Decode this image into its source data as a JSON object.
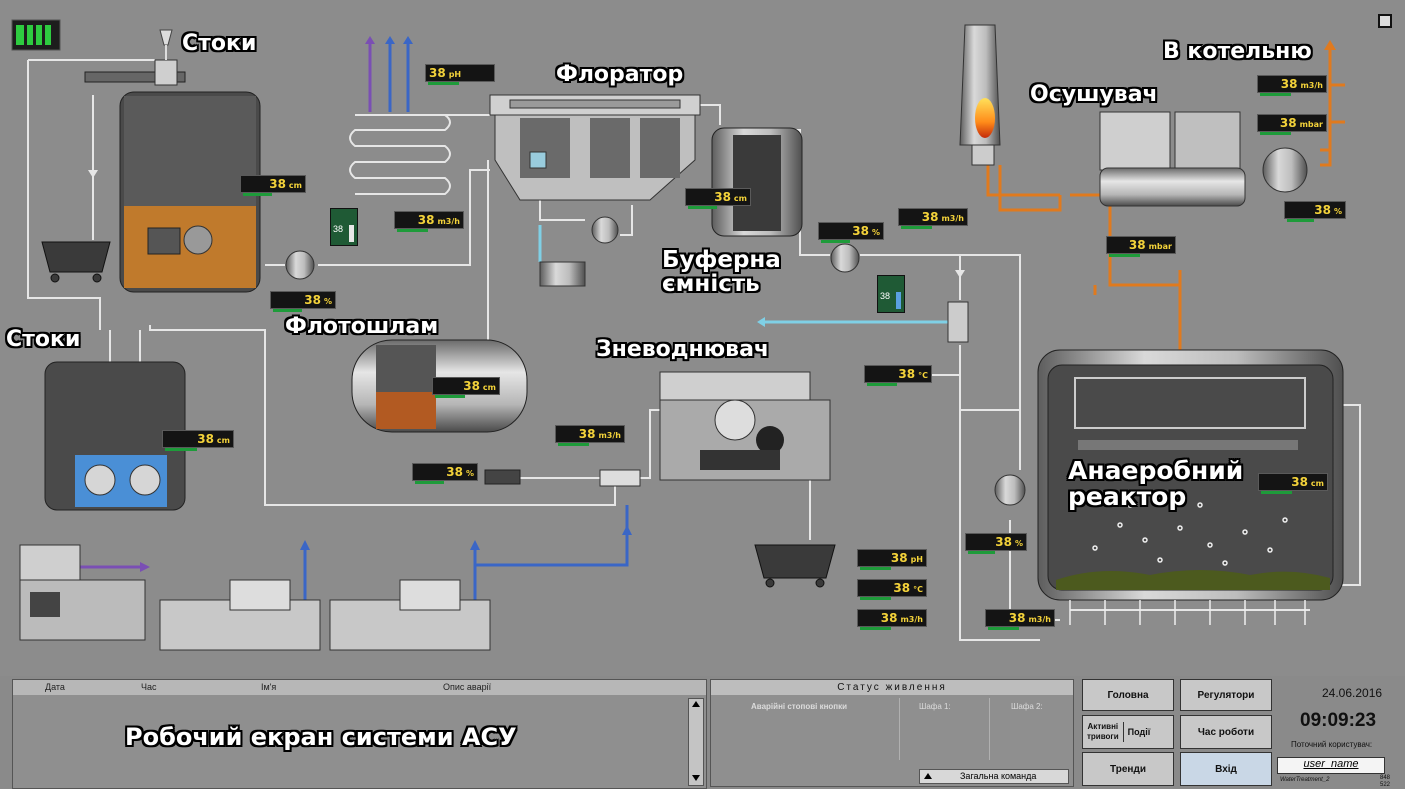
{
  "labels": {
    "stoky_top": "Стоки",
    "stoky_left": "Стоки",
    "florator": "Флоратор",
    "flotoshlam": "Флотошлам",
    "buferna": "Буферна\nємність",
    "znevodnyuvach": "Зневоднювач",
    "osushuvach": "Осушувач",
    "v_kotelnyu": "В котельню",
    "reactor": "Анаеробний\nреактор"
  },
  "readouts": {
    "r_ph_florator": {
      "value": "38",
      "unit": "pH"
    },
    "r_cm_tank1": {
      "value": "38",
      "unit": "cm"
    },
    "r_m3h_1": {
      "value": "38",
      "unit": "m3/h"
    },
    "r_pct_pump1": {
      "value": "38",
      "unit": "%"
    },
    "r_cm_buffer": {
      "value": "38",
      "unit": "cm"
    },
    "r_pct_buffer": {
      "value": "38",
      "unit": "%"
    },
    "r_m3h_buffer": {
      "value": "38",
      "unit": "m3/h"
    },
    "r_m3h_boiler": {
      "value": "38",
      "unit": "m3/h"
    },
    "r_mbar_boiler": {
      "value": "38",
      "unit": "mbar"
    },
    "r_pct_blower": {
      "value": "38",
      "unit": "%"
    },
    "r_mbar_reactor": {
      "value": "38",
      "unit": "mbar"
    },
    "r_cm_tank2": {
      "value": "38",
      "unit": "cm"
    },
    "r_cm_flotoshlam": {
      "value": "38",
      "unit": "cm"
    },
    "r_m3h_screw": {
      "value": "38",
      "unit": "m3/h"
    },
    "r_pct_screw": {
      "value": "38",
      "unit": "%"
    },
    "r_c_heat": {
      "value": "38",
      "unit": "°C"
    },
    "r_cm_reactor": {
      "value": "38",
      "unit": "cm"
    },
    "r_pct_recirc": {
      "value": "38",
      "unit": "%"
    },
    "r_ph_reactor": {
      "value": "38",
      "unit": "pH"
    },
    "r_c_reactor": {
      "value": "38",
      "unit": "°C"
    },
    "r_m3h_reactor_a": {
      "value": "38",
      "unit": "m3/h"
    },
    "r_m3h_reactor_b": {
      "value": "38",
      "unit": "m3/h"
    }
  },
  "valve_level_1": "38",
  "valve_level_1_fill": 0.55,
  "valve_level_2": "38",
  "valve_level_2_fill": 0.55,
  "alarms": {
    "col_date": "Дата",
    "col_time": "Час",
    "col_name": "Ім'я",
    "col_desc": "Опис аварії",
    "watermark": "Робочий екран системи АСУ"
  },
  "power": {
    "title": "Статус живлення",
    "col_buttons": "Аварійні стопові кнопки",
    "col_cab1": "Шафа 1:",
    "col_cab2": "Шафа 2:",
    "general_cmd": "Загальна команда"
  },
  "nav": {
    "home": "Головна",
    "regulators": "Регулятори",
    "active_alarms": "Активні\nтривоги",
    "events": "Події",
    "runtime": "Час роботи",
    "trends": "Тренди",
    "login": "Вхід"
  },
  "status": {
    "date": "24.06.2016",
    "time": "09:09:23",
    "current_user_label": "Поточний користувач:",
    "user_name": "user_name",
    "project": "WaterTreatment_2",
    "corner_a": "848",
    "corner_b": "522"
  },
  "colors": {
    "background": "#8c8c8c",
    "sludge": "#c07a2c",
    "water": "#4a8fd6",
    "gas_pipe": "#e07a1e",
    "purple_pipe": "#7a4fb4",
    "blue_pipe": "#3a66c6",
    "readout_text": "#f3d23a"
  }
}
